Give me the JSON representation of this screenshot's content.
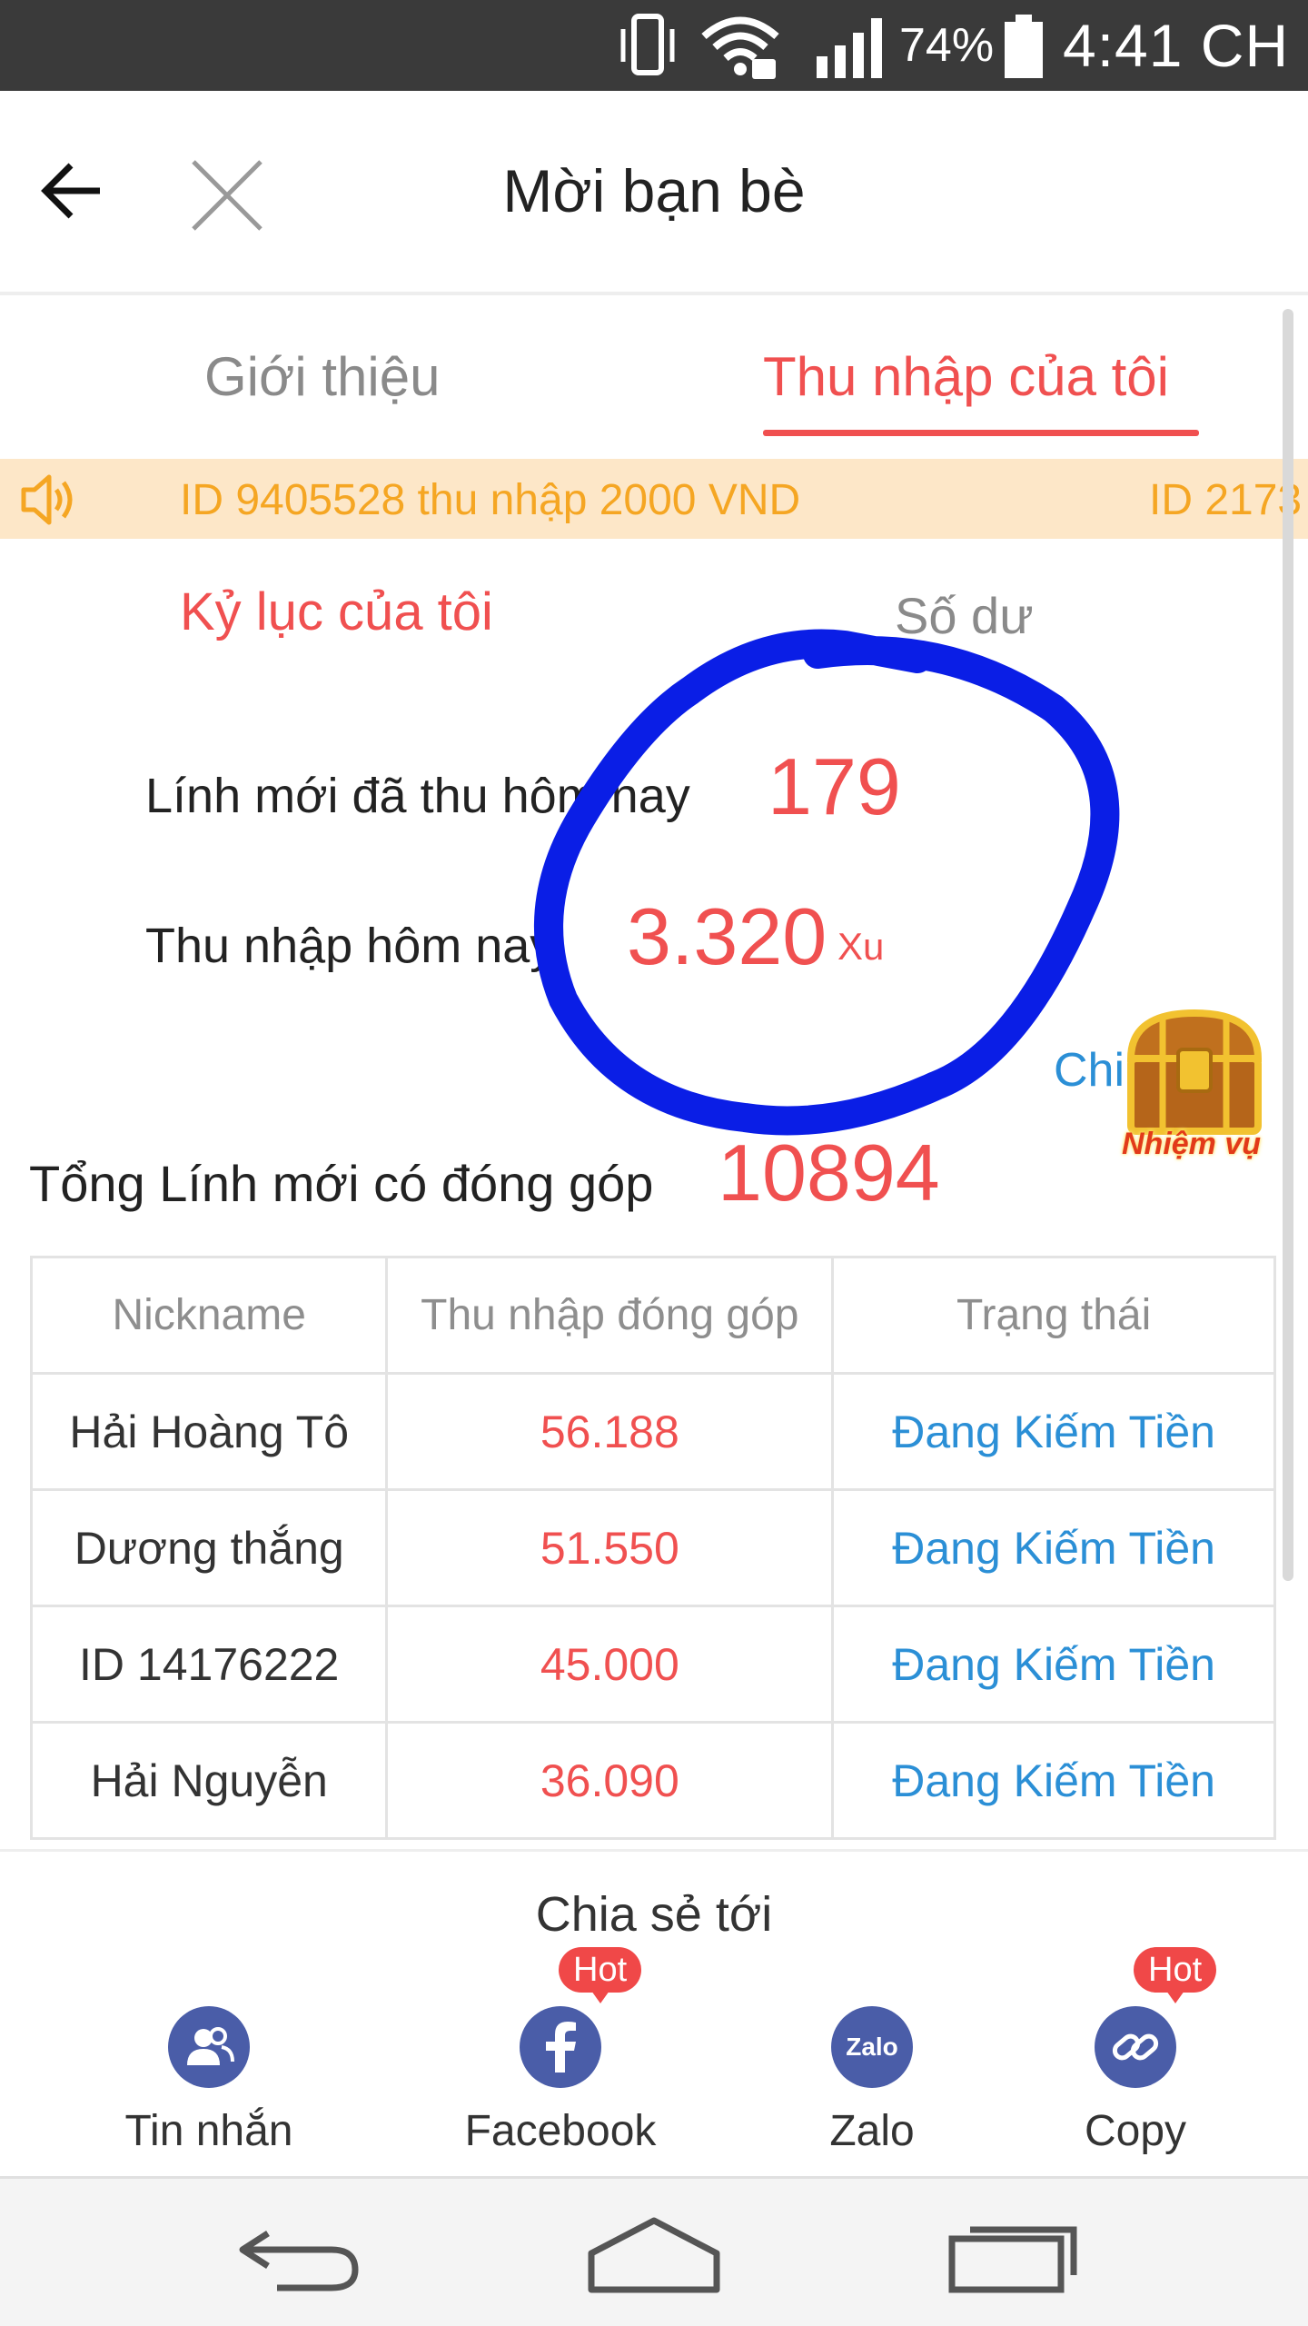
{
  "status_bar": {
    "battery_pct": "74%",
    "time": "4:41 CH",
    "icons": [
      "vibrate-icon",
      "wifi-lock-icon",
      "signal-icon",
      "battery-icon"
    ]
  },
  "header": {
    "title": "Mời bạn bè",
    "back_icon": "arrow-left-icon",
    "close_icon": "close-icon"
  },
  "tabs": [
    {
      "label": "Giới thiệu",
      "active": false
    },
    {
      "label": "Thu nhập của tôi",
      "active": true
    }
  ],
  "marquee": {
    "icon": "speaker-icon",
    "items": [
      "ID 9405528 thu nhập 2000 VND",
      "ID 2173"
    ]
  },
  "summary": {
    "section_left": "Kỷ lục của tôi",
    "section_right": "Số dư",
    "new_recruits_label": "Lính mới đã thu hôm nay",
    "new_recruits_value": "179",
    "income_label": "Thu nhập hôm nay",
    "income_value": "3.320",
    "income_unit": "Xu",
    "detail_link": "Chi tiết >",
    "mission_label": "Nhiệm vụ",
    "total_label": "Tổng Lính mới có đóng góp",
    "total_value": "10894"
  },
  "table": {
    "headers": [
      "Nickname",
      "Thu nhập đóng góp",
      "Trạng thái"
    ],
    "rows": [
      {
        "nickname": "Hải Hoàng Tô",
        "earn": "56.188",
        "status": "Đang Kiếm Tiền"
      },
      {
        "nickname": "Dương thắng",
        "earn": "51.550",
        "status": "Đang Kiếm Tiền"
      },
      {
        "nickname": "ID 14176222",
        "earn": "45.000",
        "status": "Đang Kiếm Tiền"
      },
      {
        "nickname": "Hải Nguyễn",
        "earn": "36.090",
        "status": "Đang Kiếm Tiền"
      }
    ]
  },
  "share": {
    "title": "Chia sẻ tới",
    "hot_badge": "Hot",
    "items": [
      {
        "label": "Tin nhắn",
        "icon": "contacts-icon",
        "hot": false
      },
      {
        "label": "Facebook",
        "icon": "facebook-icon",
        "hot": true
      },
      {
        "label": "Zalo",
        "icon": "zalo-icon",
        "hot": false
      },
      {
        "label": "Copy",
        "icon": "link-icon",
        "hot": true
      }
    ],
    "zalo_text": "Zalo"
  },
  "colors": {
    "accent_red": "#f05050",
    "link_blue": "#2b8fd6",
    "marquee_bg": "#fde7c8",
    "marquee_text": "#f5a623",
    "share_icon_bg": "#4a5da8",
    "annotation_blue": "#0a1ee6"
  }
}
